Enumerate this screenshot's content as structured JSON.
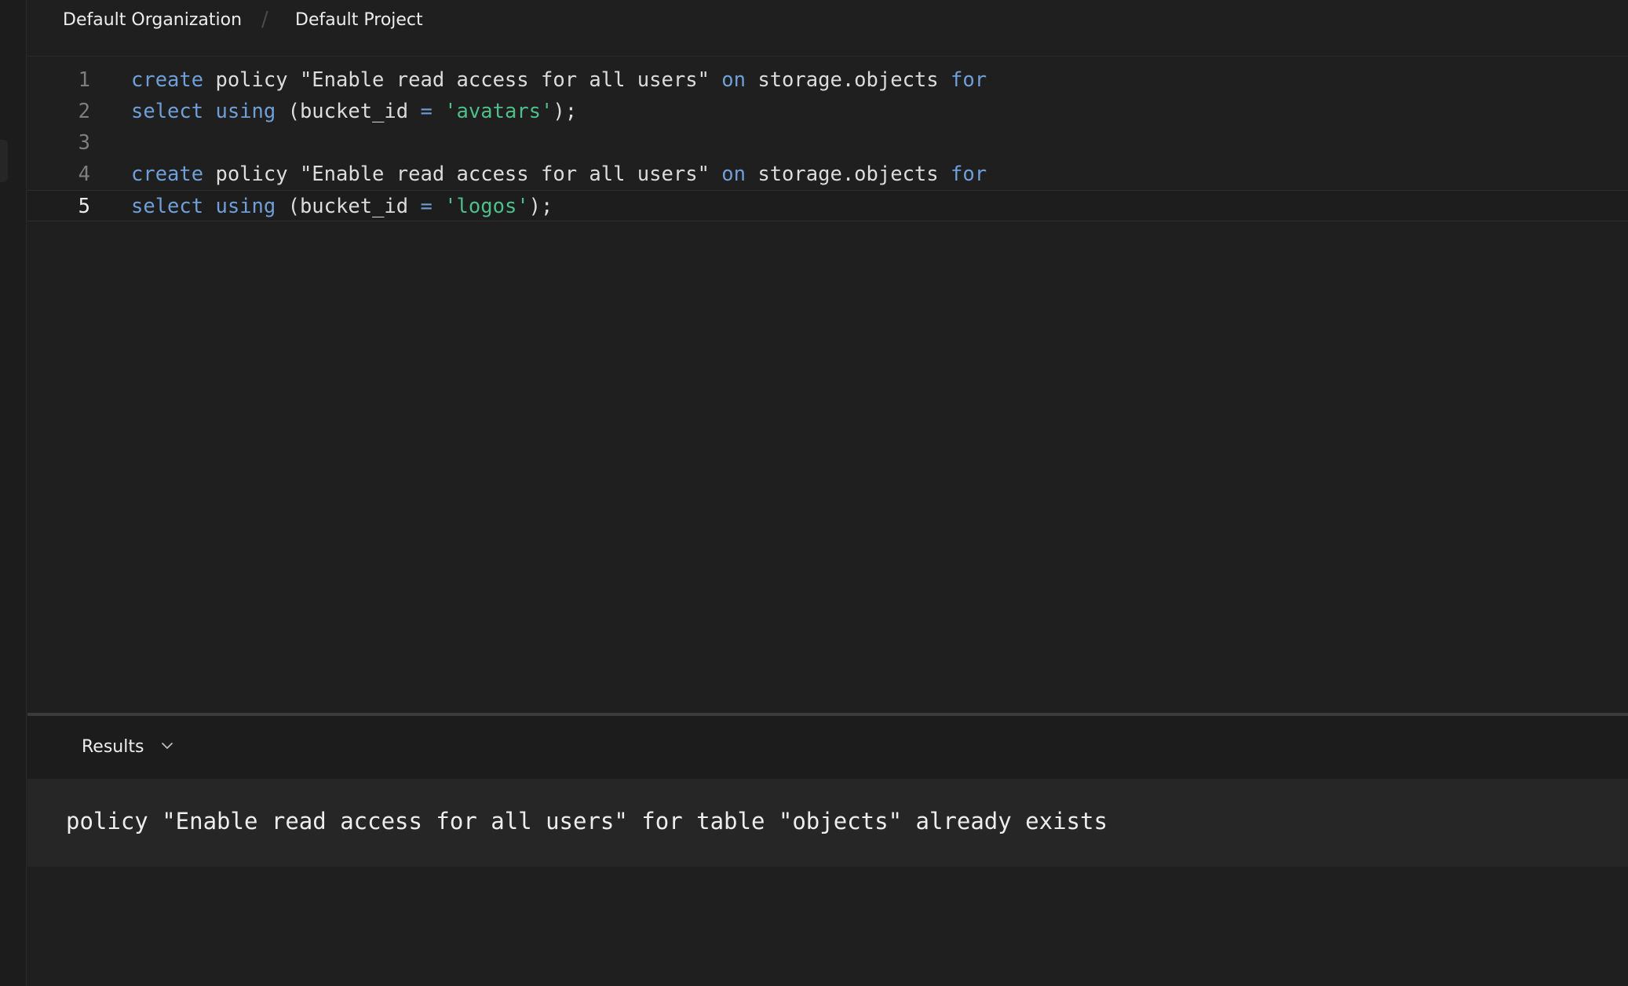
{
  "breadcrumb": {
    "organization": "Default Organization",
    "separator": "/",
    "project": "Default Project"
  },
  "editor": {
    "active_line": 5,
    "lines": [
      {
        "num": "1",
        "tokens": [
          {
            "t": "create",
            "c": "kw"
          },
          {
            "t": " policy \"Enable read access for all users\" "
          },
          {
            "t": "on",
            "c": "kw"
          },
          {
            "t": " storage.objects "
          },
          {
            "t": "for",
            "c": "kw"
          }
        ]
      },
      {
        "num": "2",
        "tokens": [
          {
            "t": "select",
            "c": "kw"
          },
          {
            "t": " "
          },
          {
            "t": "using",
            "c": "kw"
          },
          {
            "t": " (bucket_id "
          },
          {
            "t": "=",
            "c": "op"
          },
          {
            "t": " "
          },
          {
            "t": "'avatars'",
            "c": "str"
          },
          {
            "t": ");"
          }
        ]
      },
      {
        "num": "3",
        "tokens": []
      },
      {
        "num": "4",
        "tokens": [
          {
            "t": "create",
            "c": "kw"
          },
          {
            "t": " policy \"Enable read access for all users\" "
          },
          {
            "t": "on",
            "c": "kw"
          },
          {
            "t": " storage.objects "
          },
          {
            "t": "for",
            "c": "kw"
          }
        ]
      },
      {
        "num": "5",
        "tokens": [
          {
            "t": "select",
            "c": "kw"
          },
          {
            "t": " "
          },
          {
            "t": "using",
            "c": "kw"
          },
          {
            "t": " (bucket_id "
          },
          {
            "t": "=",
            "c": "op"
          },
          {
            "t": " "
          },
          {
            "t": "'logos'",
            "c": "str"
          },
          {
            "t": ");"
          }
        ]
      }
    ]
  },
  "results": {
    "label": "Results",
    "toggle_icon": "chevron-down-icon",
    "message": "policy \"Enable read access for all users\" for table \"objects\" already exists"
  },
  "colors": {
    "background": "#1f1f1f",
    "keyword": "#6f9fd8",
    "string": "#4fbf8a",
    "line_number": "#7e7e7e"
  }
}
